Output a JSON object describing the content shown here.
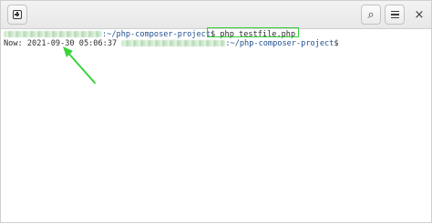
{
  "headerbar": {
    "new_tab_icon": "new-tab-icon",
    "search_icon": "search-icon",
    "search_glyph": "⌕",
    "menu_icon": "hamburger-menu-icon",
    "close_icon": "close-icon",
    "close_glyph": "×"
  },
  "terminal": {
    "line1": {
      "path": ":~/php-composer-project",
      "prompt_symbol": "$",
      "command": " php testfile.php"
    },
    "line2": {
      "output": "Now: 2021-09-30 05:06:37 ",
      "path": ":~/php-composer-project",
      "prompt_symbol": "$"
    }
  },
  "annotation": {
    "highlight_color": "#3bd23b"
  }
}
